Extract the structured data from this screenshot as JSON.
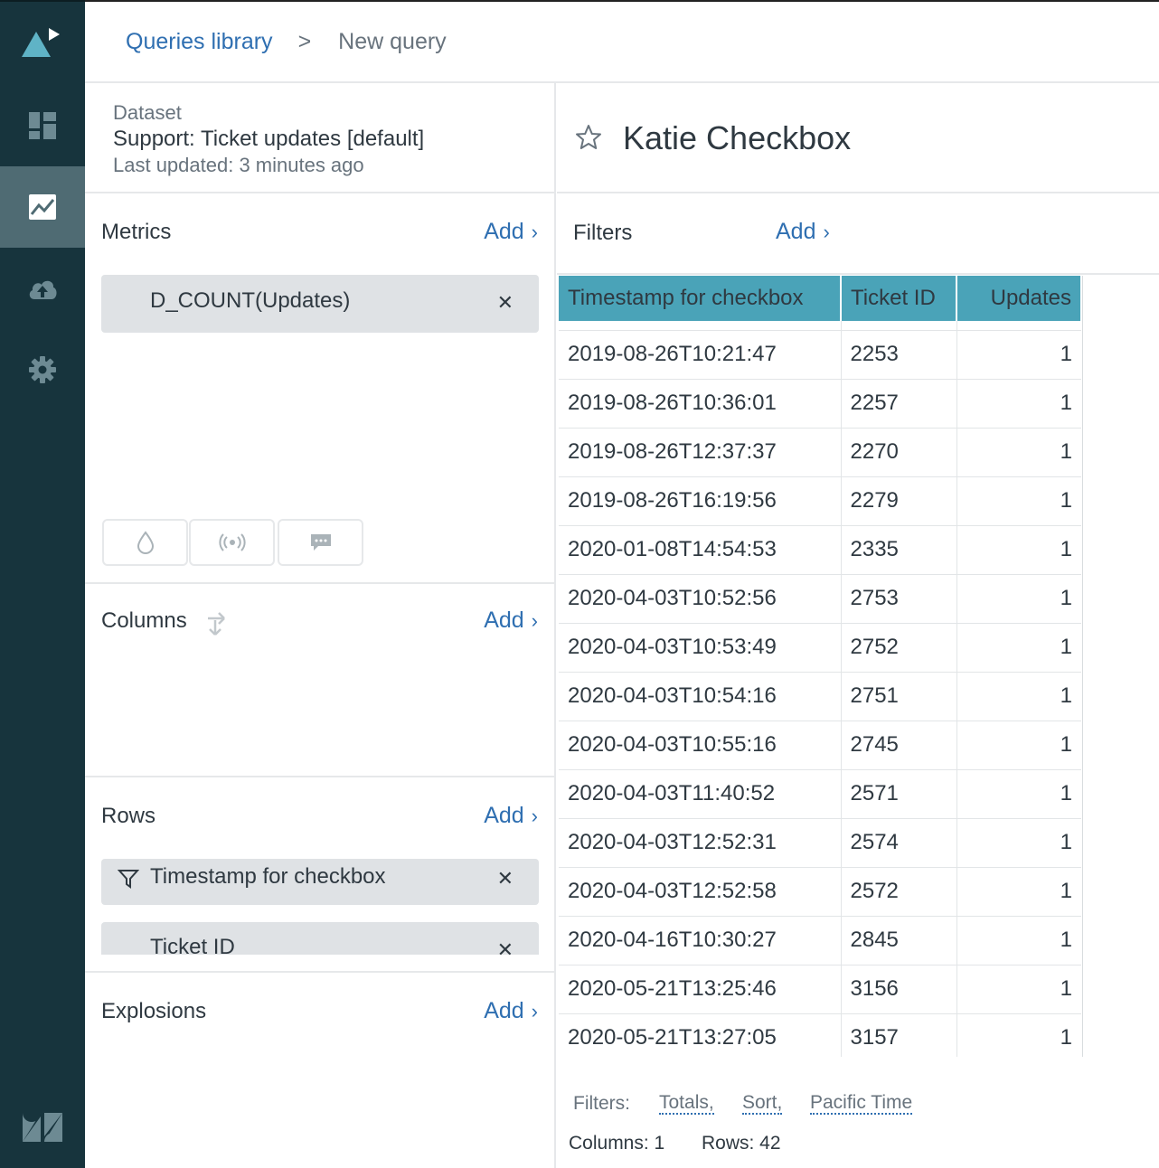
{
  "breadcrumb": {
    "library": "Queries library",
    "separator": ">",
    "current": "New query"
  },
  "sidebar": {
    "items": [
      {
        "icon": "dashboard-icon"
      },
      {
        "icon": "reporting-icon",
        "active": true
      },
      {
        "icon": "cloud-upload-icon"
      },
      {
        "icon": "gear-icon"
      }
    ]
  },
  "dataset": {
    "label": "Dataset",
    "name": "Support: Ticket updates [default]",
    "updated": "Last updated: 3 minutes ago"
  },
  "metrics": {
    "title": "Metrics",
    "add": "Add",
    "items": [
      "D_COUNT(Updates)"
    ]
  },
  "columns": {
    "title": "Columns",
    "add": "Add"
  },
  "rows": {
    "title": "Rows",
    "add": "Add",
    "items": [
      "Timestamp for checkbox",
      "Ticket ID"
    ]
  },
  "explosions": {
    "title": "Explosions",
    "add": "Add"
  },
  "query": {
    "title": "Katie Checkbox"
  },
  "filters": {
    "title": "Filters",
    "add": "Add"
  },
  "table": {
    "headers": [
      "Timestamp for checkbox",
      "Ticket ID",
      "Updates"
    ],
    "rows": [
      [
        "2019-08-26T10:21:47",
        "2253",
        "1"
      ],
      [
        "2019-08-26T10:36:01",
        "2257",
        "1"
      ],
      [
        "2019-08-26T12:37:37",
        "2270",
        "1"
      ],
      [
        "2019-08-26T16:19:56",
        "2279",
        "1"
      ],
      [
        "2020-01-08T14:54:53",
        "2335",
        "1"
      ],
      [
        "2020-04-03T10:52:56",
        "2753",
        "1"
      ],
      [
        "2020-04-03T10:53:49",
        "2752",
        "1"
      ],
      [
        "2020-04-03T10:54:16",
        "2751",
        "1"
      ],
      [
        "2020-04-03T10:55:16",
        "2745",
        "1"
      ],
      [
        "2020-04-03T11:40:52",
        "2571",
        "1"
      ],
      [
        "2020-04-03T12:52:31",
        "2574",
        "1"
      ],
      [
        "2020-04-03T12:52:58",
        "2572",
        "1"
      ],
      [
        "2020-04-16T10:30:27",
        "2845",
        "1"
      ],
      [
        "2020-05-21T13:25:46",
        "3156",
        "1"
      ],
      [
        "2020-05-21T13:27:05",
        "3157",
        "1"
      ]
    ]
  },
  "footer": {
    "filters_label": "Filters:",
    "links": [
      "Totals,",
      "Sort,",
      "Pacific Time"
    ],
    "columns": "Columns: 1",
    "rows": "Rows: 42"
  },
  "colors": {
    "sidebar": "#17343d",
    "accent": "#2f6fb1",
    "table_header": "#4aa3b8"
  }
}
